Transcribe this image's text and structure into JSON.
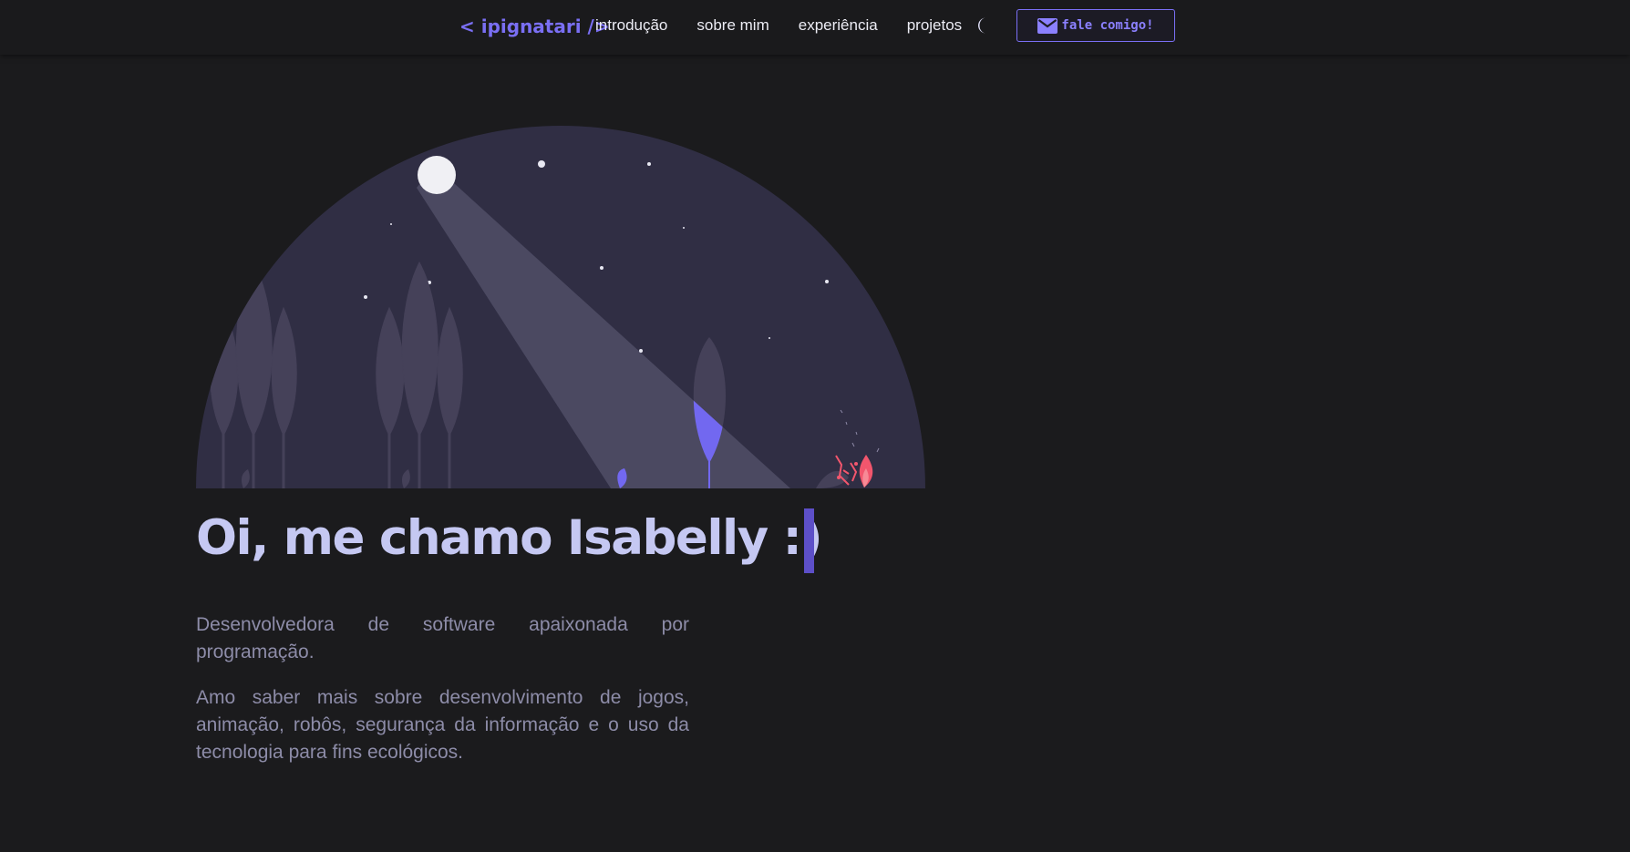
{
  "header": {
    "logo": "< ipignatari />",
    "nav": [
      {
        "label": "introdução"
      },
      {
        "label": "sobre mim"
      },
      {
        "label": "experiência"
      },
      {
        "label": "projetos"
      }
    ],
    "theme_toggle_icon": "moon-icon",
    "contact": {
      "label": "fale comigo!",
      "icon": "mail-icon"
    }
  },
  "hero": {
    "illustration": "night-forest-moonlight-campfire",
    "headline": "Oi, me chamo Isabelly :)",
    "bio_1": "Desenvolvedora de software apaixonada por programação.",
    "bio_2": "Amo saber mais sobre desenvolvimento de jogos, animação, robôs, segurança da informação e o uso da tecnologia para fins ecológicos."
  },
  "colors": {
    "background": "#1b1b1d",
    "accent": "#7a6ff4",
    "headline": "#c5c8f2",
    "body_text": "#8d8ca8",
    "sky": "#302e44",
    "fire": "#f2566d"
  }
}
